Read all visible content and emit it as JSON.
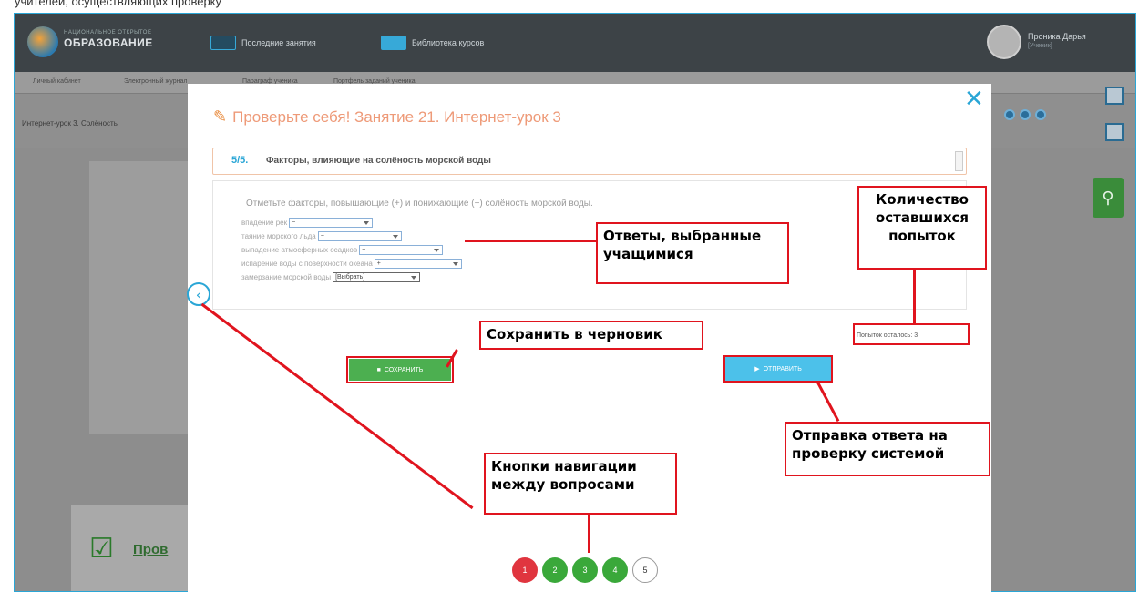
{
  "caption_top": "учителей, осуществляющих проверку",
  "app": {
    "logo_small": "НАЦИОНАЛЬНОЕ ОТКРЫТОЕ",
    "logo_text": "ОБРАЗОВАНИЕ",
    "nav_recent": "Последние занятия",
    "nav_library": "Библиотека курсов",
    "user_name": "Проника Дарья",
    "user_role": "[Ученик]"
  },
  "breadcrumbs": [
    "Личный кабинет",
    "Электронный журнал",
    "Параграф ученика",
    "Портфель заданий ученика"
  ],
  "lesson_title": "Интернет-урок 3. Солёность",
  "modal": {
    "title": "Проверьте себя! Занятие 21. Интернет-урок 3",
    "question_number": "5/5.",
    "question_title": "Факторы, влияющие на солёность морской воды",
    "instruction": "Отметьте факторы, повышающие (+) и понижающие (−) солёность морской воды.",
    "factors": [
      {
        "label": "впадение рек",
        "value": "−"
      },
      {
        "label": "таяние морского льда",
        "value": "−"
      },
      {
        "label": "выпадение атмосферных осадков",
        "value": "−"
      },
      {
        "label": "испарение воды с поверхности океана",
        "value": "+"
      },
      {
        "label": "замерзание морской воды",
        "value": "[Выбрать]"
      }
    ],
    "attempts_left": "Попыток осталось: 3",
    "save_label": "СОХРАНИТЬ",
    "send_label": "ОТПРАВИТЬ",
    "pages": [
      "1",
      "2",
      "3",
      "4",
      "5"
    ]
  },
  "background_lower_text": "Пров",
  "annotations": {
    "answers": "Ответы, выбранные учащимися",
    "attempts": "Количество оставшихся попыток",
    "save": "Сохранить в черновик",
    "send": "Отправка ответа на проверку системой",
    "navigation": "Кнопки навигации между вопросами"
  },
  "colors": {
    "accent": "#2aa6d6",
    "title": "#ee9a78",
    "save": "#4caf50",
    "send": "#4cc1ea",
    "annotation": "#e0141e"
  }
}
